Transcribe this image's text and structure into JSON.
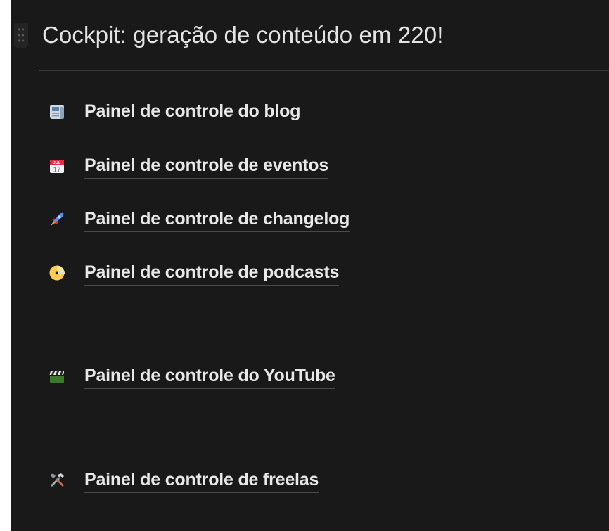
{
  "page": {
    "heading": "Cockpit: geração de conteúdo em 220!"
  },
  "links": [
    {
      "label": "Painel de controle do blog",
      "icon": "newspaper-icon"
    },
    {
      "label": "Painel de controle de eventos",
      "icon": "calendar-icon",
      "icon_text_top": "JUL",
      "icon_text_day": "17"
    },
    {
      "label": "Painel de controle de changelog",
      "icon": "rocket-icon"
    },
    {
      "label": "Painel de controle de podcasts",
      "icon": "dvd-icon"
    },
    {
      "label": "Painel de controle do YouTube",
      "icon": "clapper-board-icon"
    },
    {
      "label": "Painel de controle de freelas",
      "icon": "hammer-wrench-icon"
    }
  ],
  "colors": {
    "background": "#191919",
    "text": "#e8e8e8",
    "underline": "#4a4a4a",
    "divider": "#373737"
  }
}
